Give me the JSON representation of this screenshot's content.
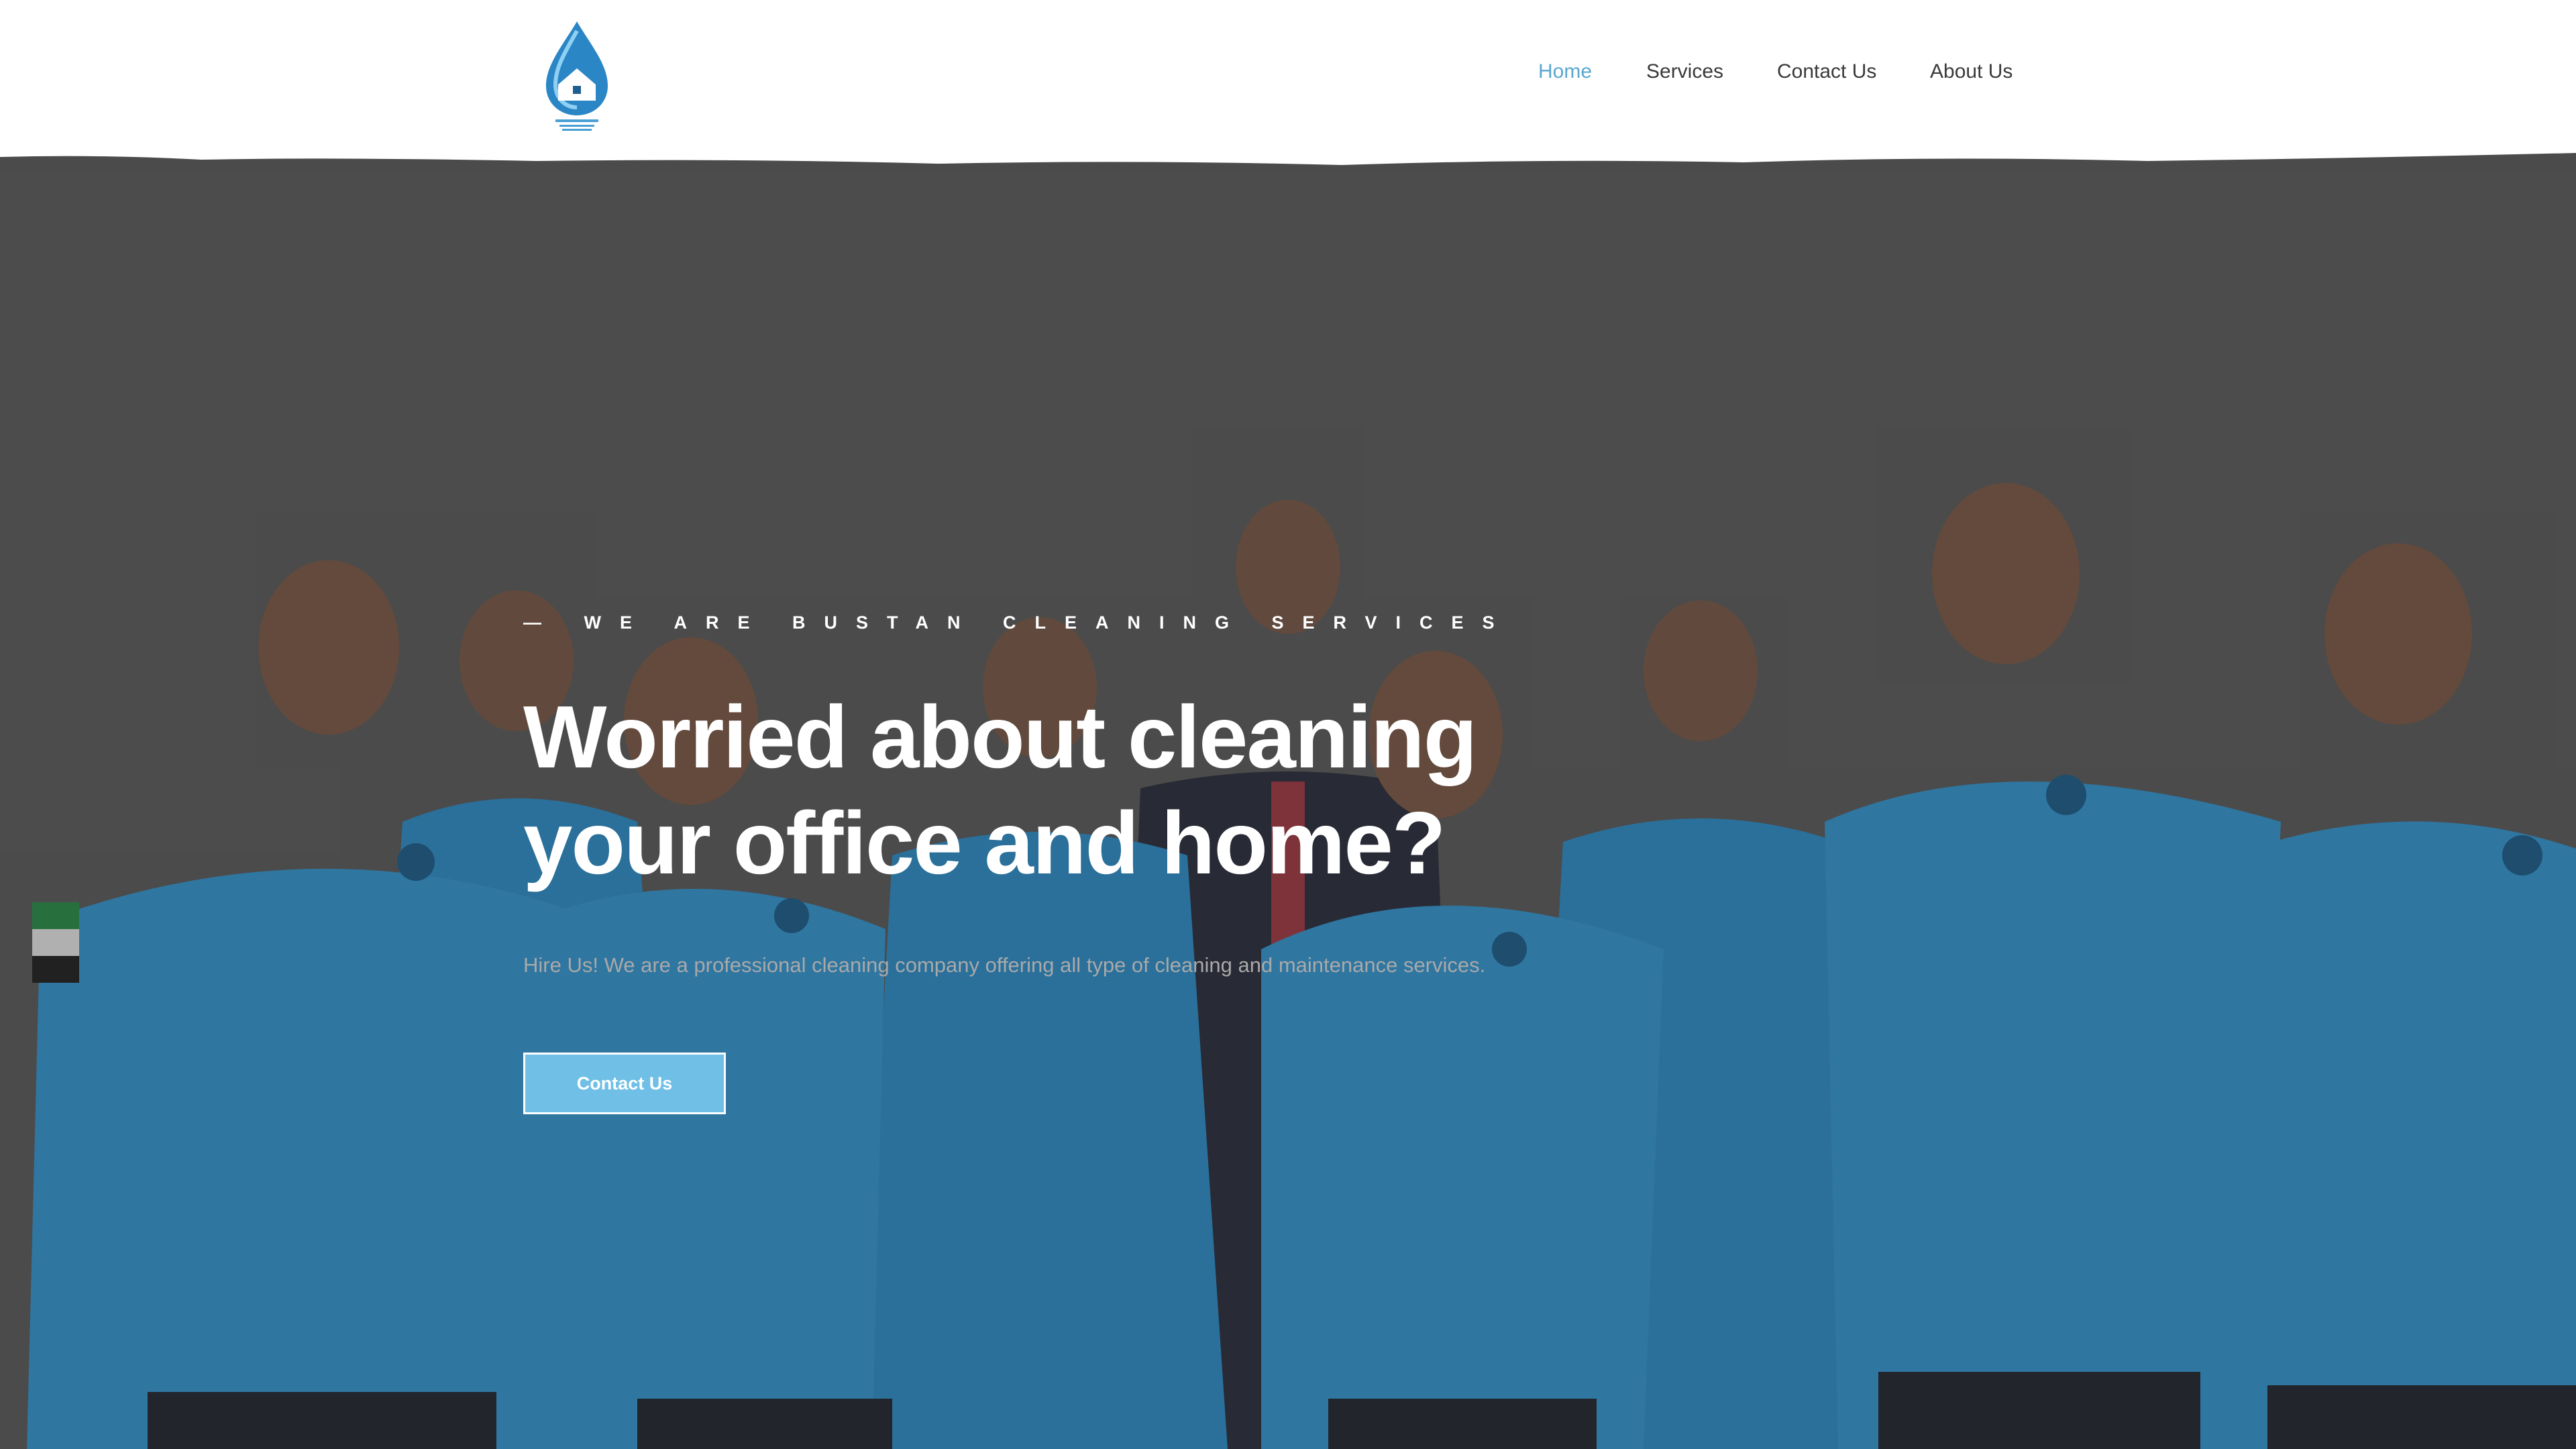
{
  "nav": {
    "items": [
      {
        "label": "Home",
        "active": true
      },
      {
        "label": "Services",
        "active": false
      },
      {
        "label": "Contact Us",
        "active": false
      },
      {
        "label": "About Us",
        "active": false
      }
    ]
  },
  "hero": {
    "tagline": "— WE ARE BUSTAN CLEANING SERVICES",
    "headline_line1": "Worried about cleaning",
    "headline_line2": "your office and home?",
    "subtext": "Hire Us! We are a professional cleaning company offering all type of cleaning and maintenance services.",
    "cta_label": "Contact Us"
  },
  "colors": {
    "accent": "#5aa7d1",
    "button": "#6fbfe6",
    "shirt": "#2f8fc9",
    "overlay": "#5c5c5c"
  }
}
